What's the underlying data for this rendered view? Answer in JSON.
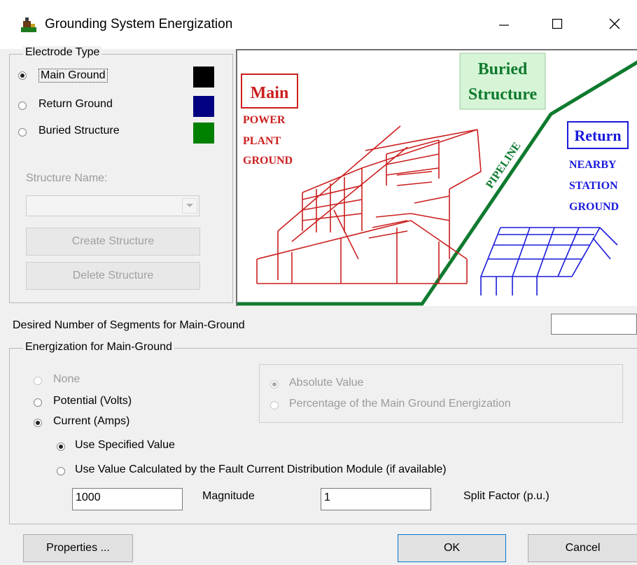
{
  "window": {
    "title": "Grounding System Energization",
    "minimize_icon": "minimize-icon",
    "maximize_icon": "maximize-icon",
    "close_icon": "close-icon"
  },
  "electrode_type": {
    "legend": "Electrode Type",
    "options": [
      {
        "label": "Main Ground",
        "checked": true,
        "color": "#000000"
      },
      {
        "label": "Return Ground",
        "checked": false,
        "color": "#000080"
      },
      {
        "label": "Buried Structure",
        "checked": false,
        "color": "#008000"
      }
    ],
    "structure_name_label": "Structure Name:",
    "structure_name_value": "",
    "create_structure": "Create Structure",
    "delete_structure": "Delete Structure"
  },
  "diagram": {
    "main_box": "Main",
    "main_caption": [
      "POWER",
      "PLANT",
      "GROUND"
    ],
    "buried_box": [
      "Buried",
      "Structure"
    ],
    "pipeline": "PIPELINE",
    "return_box": "Return",
    "return_caption": [
      "NEARBY",
      "STATION",
      "GROUND"
    ],
    "colors": {
      "main": "#cc1f1f",
      "return": "#1a1adb",
      "pipeline": "#0f7a2e",
      "buried_box_bg": "#d6f5d6"
    }
  },
  "segments": {
    "label": "Desired Number of Segments for Main-Ground",
    "value": ""
  },
  "energization": {
    "legend": "Energization for Main-Ground",
    "options": [
      {
        "label": "None",
        "checked": false,
        "disabled": true
      },
      {
        "label": "Potential (Volts)",
        "checked": false,
        "disabled": false
      },
      {
        "label": "Current (Amps)",
        "checked": true,
        "disabled": false
      }
    ],
    "value_options": [
      {
        "label": "Absolute Value",
        "checked": true,
        "disabled": true
      },
      {
        "label": "Percentage of the Main Ground Energization",
        "checked": false,
        "disabled": true
      }
    ],
    "current_options": [
      {
        "label": "Use Specified Value",
        "checked": true
      },
      {
        "label": "Use Value Calculated by the Fault Current Distribution Module (if available)",
        "checked": false
      }
    ],
    "magnitude_value": "1000",
    "magnitude_label": "Magnitude",
    "split_factor_value": "1",
    "split_factor_label": "Split Factor (p.u.)"
  },
  "buttons": {
    "properties": "Properties ...",
    "ok": "OK",
    "cancel": "Cancel"
  }
}
